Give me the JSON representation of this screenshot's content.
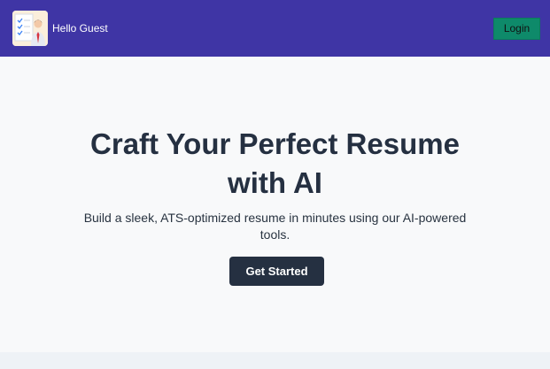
{
  "header": {
    "logo_icon": "resume-checklist-person-icon",
    "greeting": "Hello Guest",
    "login_label": "Login"
  },
  "hero": {
    "title": "Craft Your Perfect Resume with AI",
    "subtitle": "Build a sleek, ATS-optimized resume in minutes using our AI-powered tools.",
    "cta_label": "Get Started"
  },
  "colors": {
    "navbar_bg": "#3f35a5",
    "login_bg": "#0e8a6a",
    "hero_bg": "#f8f9fa",
    "cta_bg": "#253041",
    "heading_text": "#253041"
  }
}
